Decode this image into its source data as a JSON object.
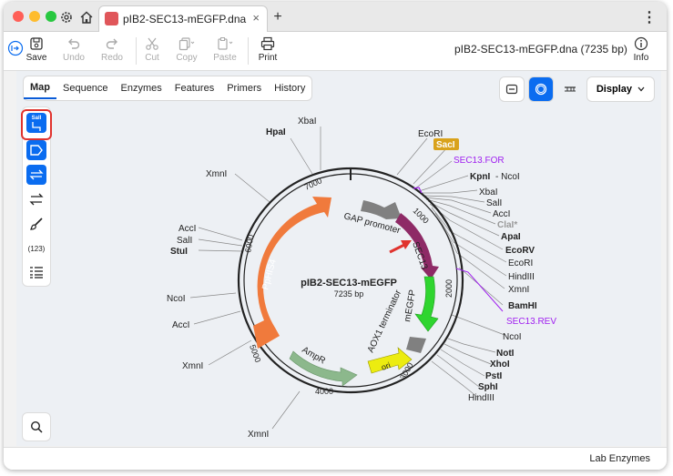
{
  "window": {
    "tab_title": "pIB2-SEC13-mEGFP.dna",
    "tab_close": "×",
    "new_tab": "+",
    "menu_dots": "⋮",
    "colors": {
      "accent": "#0a6cf0",
      "highlight": "#e0332e"
    }
  },
  "toolbar": {
    "save": "Save",
    "undo": "Undo",
    "redo": "Redo",
    "cut": "Cut",
    "copy": "Copy",
    "paste": "Paste",
    "print": "Print",
    "info": "Info",
    "doc_title": "pIB2-SEC13-mEGFP.dna  (7235 bp)"
  },
  "views": {
    "tabs": [
      "Map",
      "Sequence",
      "Enzymes",
      "Features",
      "Primers",
      "History"
    ],
    "active": "Map",
    "display_label": "Display"
  },
  "left_tools": {
    "sali_label": "SalI",
    "count_label": "(123)"
  },
  "map": {
    "name": "pIB2-SEC13-mEGFP",
    "length": "7235 bp",
    "ticks": [
      "1000",
      "2000",
      "3000",
      "4000",
      "5000",
      "6000",
      "7000"
    ],
    "features": [
      "GAP promoter",
      "SEC13",
      "mEGFP",
      "AOX1 terminator",
      "ori",
      "AmpR",
      "PpHIS4"
    ],
    "feature_colors": {
      "gap": "#808080",
      "sec13": "#8e2a66",
      "megfp": "#2fd52f",
      "aox1": "#808080",
      "ori": "#ecec10",
      "ampr": "#8cb88c",
      "pphis4": "#f07a3c"
    },
    "enzymes": {
      "xbai_top": "XbaI",
      "hpai": "HpaI",
      "xmni_a": "XmnI",
      "acci_a": "AccI",
      "sali_a": "SalI",
      "stui": "StuI",
      "ncoi_a": "NcoI",
      "acci_b": "AccI",
      "xmni_b": "XmnI",
      "xmni_c": "XmnI",
      "ecori_a": "EcoRI",
      "saci": "SacI",
      "sec13_for": "SEC13.FOR",
      "kpni": "KpnI",
      "ncoi_dash": "- NcoI",
      "xbai_b": "XbaI",
      "sali_b": "SalI",
      "acci_c": "AccI",
      "clai": "ClaI*",
      "apai": "ApaI",
      "ecorv": "EcoRV",
      "ecori_b": "EcoRI",
      "hindiii_a": "HindIII",
      "xmni_d": "XmnI",
      "bamhi": "BamHI",
      "sec13_rev": "SEC13.REV",
      "ncoi_b": "NcoI",
      "noti": "NotI",
      "xhoi": "XhoI",
      "psti": "PstI",
      "sphi": "SphI",
      "hindiii_b": "HindIII"
    }
  },
  "status": {
    "right": "Lab Enzymes"
  }
}
